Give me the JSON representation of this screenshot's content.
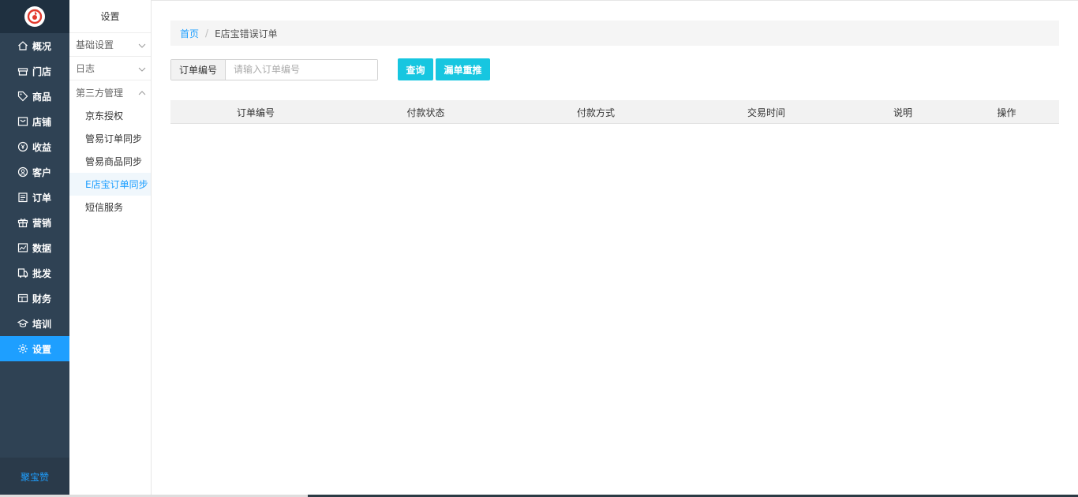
{
  "sidebar": {
    "logo": "logo-icon",
    "items": [
      {
        "label": "概况",
        "icon": "home-icon"
      },
      {
        "label": "门店",
        "icon": "store-icon"
      },
      {
        "label": "商品",
        "icon": "tag-icon"
      },
      {
        "label": "店铺",
        "icon": "shop-icon"
      },
      {
        "label": "收益",
        "icon": "yen-icon"
      },
      {
        "label": "客户",
        "icon": "user-icon"
      },
      {
        "label": "订单",
        "icon": "order-icon"
      },
      {
        "label": "营销",
        "icon": "gift-icon"
      },
      {
        "label": "数据",
        "icon": "chart-icon"
      },
      {
        "label": "批发",
        "icon": "wholesale-icon"
      },
      {
        "label": "财务",
        "icon": "finance-icon"
      },
      {
        "label": "培训",
        "icon": "training-icon"
      },
      {
        "label": "设置",
        "icon": "gear-icon",
        "active": true
      }
    ],
    "brand": "聚宝赞"
  },
  "submenu": {
    "title": "设置",
    "groups": [
      {
        "label": "基础设置",
        "expanded": false
      },
      {
        "label": "日志",
        "expanded": false
      },
      {
        "label": "第三方管理",
        "expanded": true
      }
    ],
    "items": [
      "京东授权",
      "管易订单同步",
      "管易商品同步",
      "E店宝订单同步",
      "短信服务"
    ],
    "active_item": "E店宝订单同步"
  },
  "breadcrumb": {
    "home": "首页",
    "separator": "/",
    "current": "E店宝错误订单"
  },
  "search": {
    "label": "订单编号",
    "placeholder": "请输入订单编号",
    "value": ""
  },
  "buttons": {
    "query": "查询",
    "repush": "漏单重推"
  },
  "table": {
    "columns": [
      "订单编号",
      "付款状态",
      "付款方式",
      "交易时间",
      "说明",
      "操作"
    ],
    "rows": []
  },
  "colors": {
    "sidebar_bg": "#2f4254",
    "accent": "#1e9fff",
    "button": "#17c6e0"
  }
}
